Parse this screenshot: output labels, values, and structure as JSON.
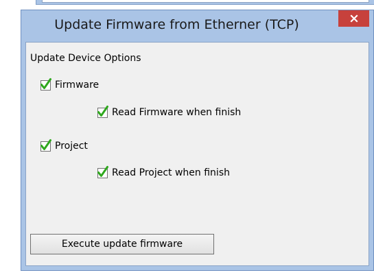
{
  "window": {
    "title": "Update Firmware from Etherner (TCP)",
    "close_icon": "close-icon",
    "close_color": "#c7413c"
  },
  "group": {
    "label": "Update Device Options"
  },
  "options": {
    "firmware": {
      "label": "Firmware",
      "checked": true
    },
    "read_firmware": {
      "label": "Read Firmware when finish",
      "checked": true
    },
    "project": {
      "label": "Project",
      "checked": true
    },
    "read_project": {
      "label": "Read Project when finish",
      "checked": true
    }
  },
  "actions": {
    "execute_label": "Execute update firmware"
  },
  "colors": {
    "frame": "#aac4e6",
    "checkmark": "#2fa81e"
  }
}
